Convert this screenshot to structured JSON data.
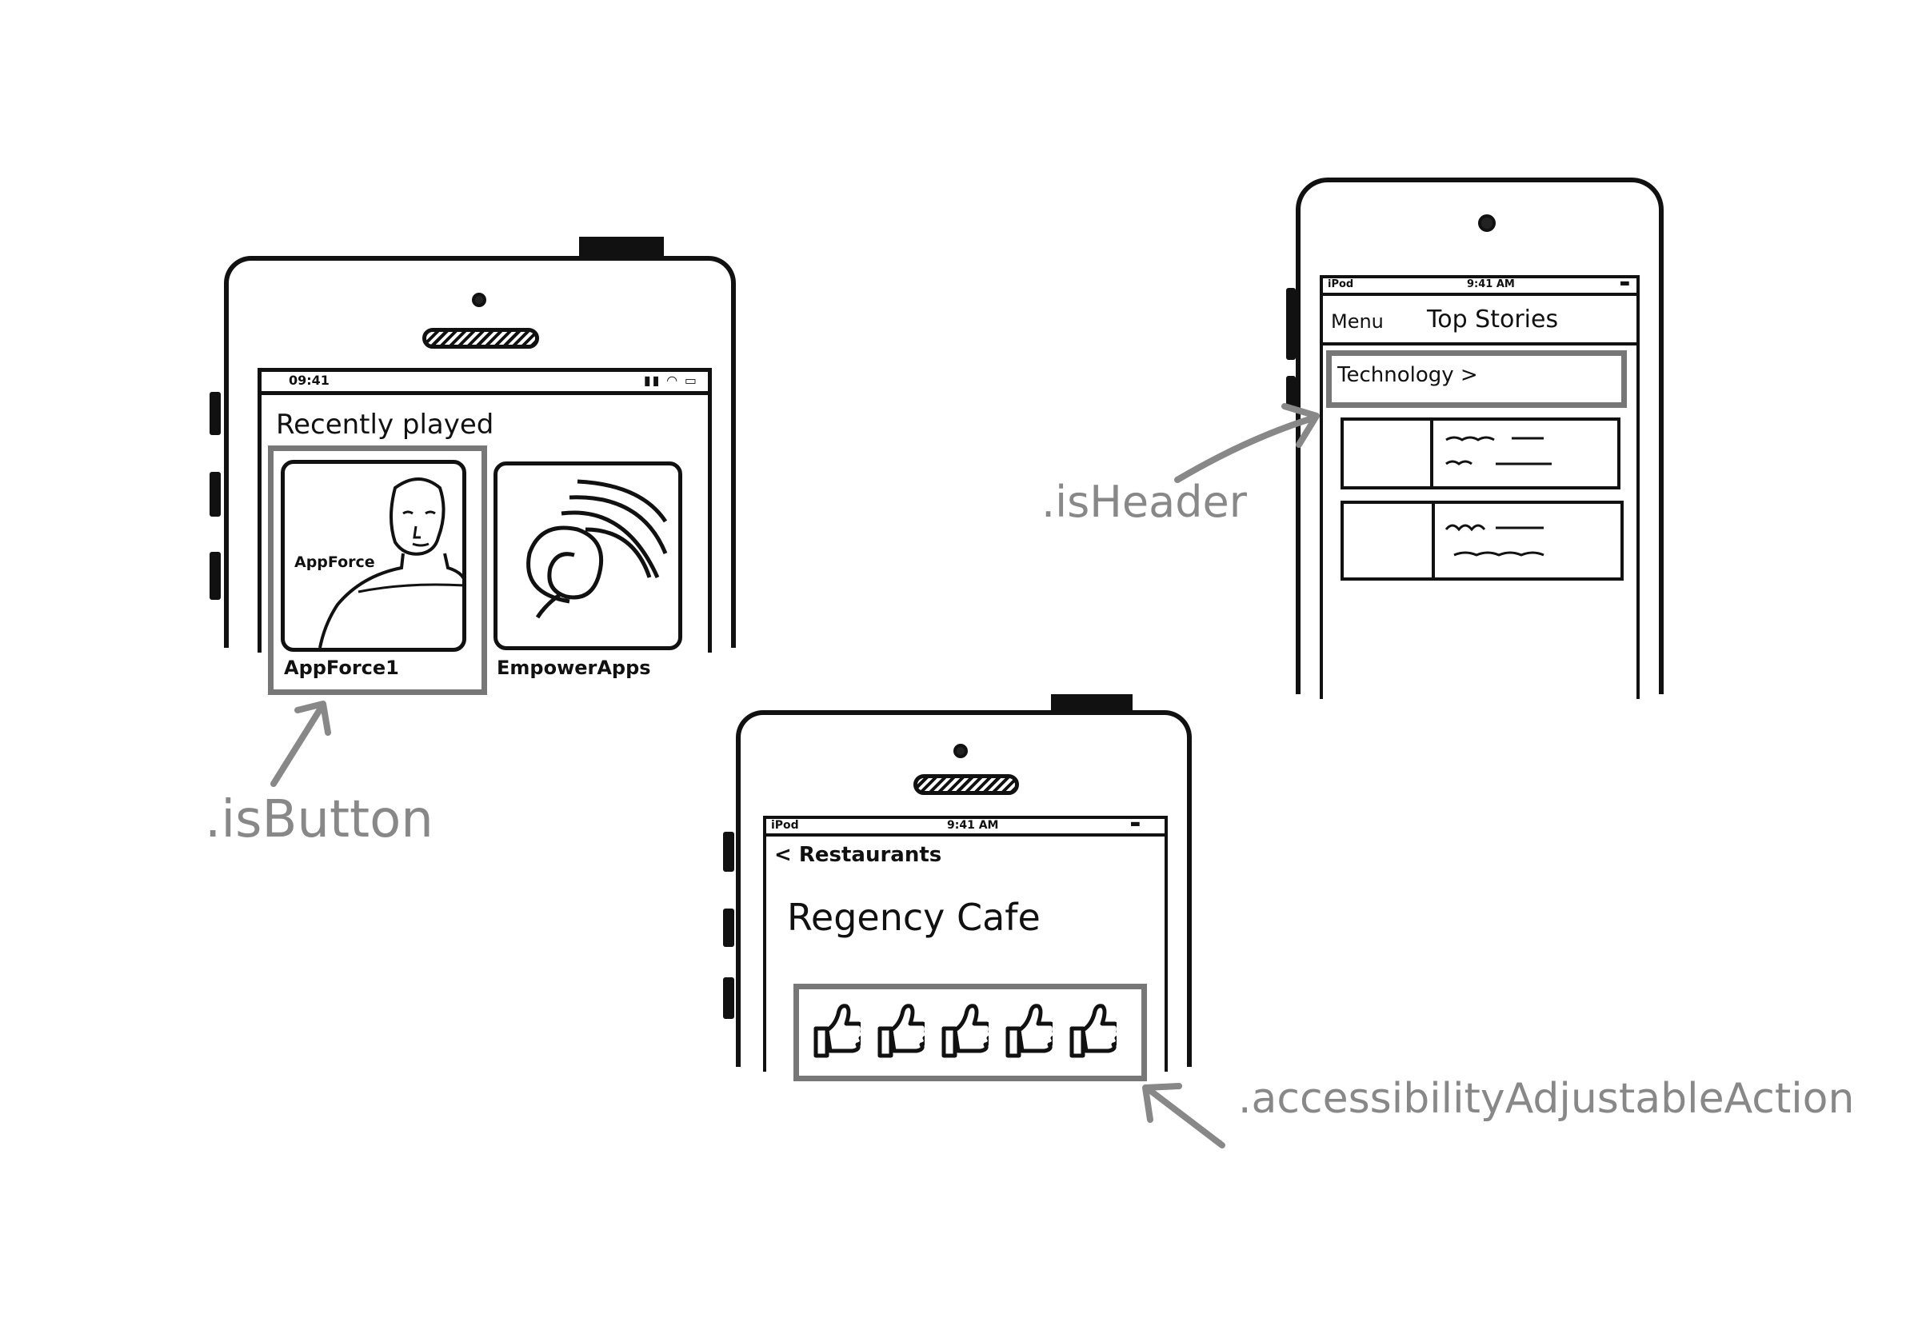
{
  "phone_music": {
    "status_time": "09:41",
    "section_title": "Recently played",
    "cards": [
      {
        "title": "AppForce1",
        "art_text": "AppForce"
      },
      {
        "title": "EmpowerApps"
      }
    ]
  },
  "phone_news": {
    "status_carrier": "iPod",
    "status_time": "9:41 AM",
    "nav_left": "Menu",
    "nav_title": "Top Stories",
    "section_header": "Technology >"
  },
  "phone_restaurant": {
    "status_carrier": "iPod",
    "status_time": "9:41 AM",
    "back_label": "< Restaurants",
    "title": "Regency Cafe",
    "rating_icons": [
      "thumbs-up",
      "thumbs-up",
      "thumbs-up",
      "thumbs-up",
      "thumbs-up"
    ]
  },
  "annotations": {
    "button": ".isButton",
    "header": ".isHeader",
    "adjustable": ".accessibilityAdjustableAction"
  },
  "colors": {
    "ink": "#111111",
    "highlight": "#777777",
    "annotation": "#888888"
  }
}
